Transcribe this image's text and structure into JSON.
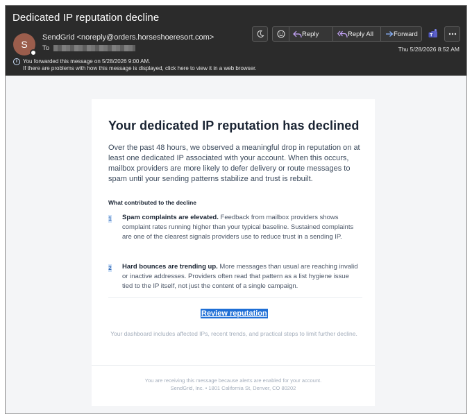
{
  "window": {
    "subject": "Dedicated IP reputation decline"
  },
  "message": {
    "avatar_initial": "S",
    "sender": "SendGrid <noreply@orders.horseshoeresort.com>",
    "to_label": "To",
    "forwarded_notice": "You forwarded this message on 5/28/2026 9:00 AM.",
    "display_notice": "If there are problems with how this message is displayed, click here to view it in a web browser.",
    "datetime": "Thu 5/28/2026 8:52 AM"
  },
  "toolbar": {
    "reply_label": "Reply",
    "reply_all_label": "Reply All",
    "forward_label": "Forward"
  },
  "email": {
    "title": "Your dedicated IP reputation has declined",
    "intro": "Over the past 48 hours, we observed a meaningful drop in reputation on at least one dedicated IP associated with your account. When this occurs, mailbox providers are more likely to defer delivery or route messages to spam until your sending patterns stabilize and trust is rebuilt.",
    "section_heading": "What contributed to the decline",
    "items": [
      {
        "number": "1",
        "heading": "Spam complaints are elevated.",
        "body": "Feedback from mailbox providers shows complaint rates running higher than your typical baseline. Sustained complaints are one of the clearest signals providers use to reduce trust in a sending IP."
      },
      {
        "number": "2",
        "heading": "Hard bounces are trending up.",
        "body": "More messages than usual are reaching invalid or inactive addresses. Providers often read that pattern as a list hygiene issue tied to the IP itself, not just the content of a single campaign."
      }
    ],
    "cta_label": "Review reputation",
    "cta_note": "Your dashboard includes affected IPs, recent trends, and practical steps to limit further decline.",
    "footer_line1": "You are receiving this message because alerts are enabled for your account.",
    "footer_line2": "SendGrid, Inc. • 1801 California St, Denver, CO 80202"
  }
}
